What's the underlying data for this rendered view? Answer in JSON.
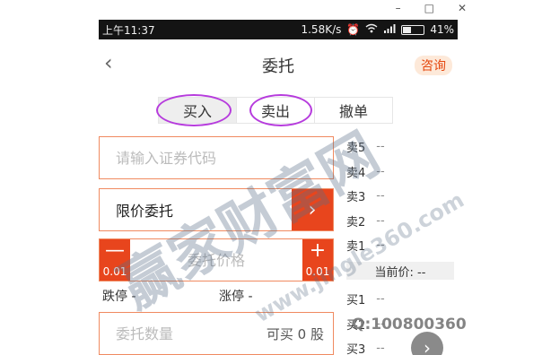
{
  "window": {
    "minimize_glyph": "–",
    "maximize_glyph": "□",
    "close_glyph": "✕"
  },
  "statusbar": {
    "time": "上午11:37",
    "net_speed": "1.58K/s",
    "battery": "41%",
    "battery_level": 0.41,
    "icons": [
      "alarm-icon",
      "wifi-icon",
      "signal-icon",
      "battery-icon"
    ]
  },
  "header": {
    "back_glyph": "‹",
    "title": "委托",
    "consult_label": "咨询"
  },
  "tabs": [
    {
      "label": "买入",
      "active": true
    },
    {
      "label": "卖出",
      "active": false
    },
    {
      "label": "撤单",
      "active": false
    }
  ],
  "form": {
    "code_placeholder": "请输入证券代码",
    "order_type": "限价委托",
    "order_type_arrow": "›",
    "minus_glyph": "—",
    "plus_glyph": "+",
    "step_minus": "0.01",
    "step_plus": "0.01",
    "price_placeholder": "委托价格",
    "limit_down": "跌停 -",
    "limit_up": "涨停 -",
    "qty_placeholder": "委托数量",
    "can_buy": "可买 0 股"
  },
  "book": {
    "sells": [
      {
        "label": "卖5",
        "value": "--"
      },
      {
        "label": "卖4",
        "value": "--"
      },
      {
        "label": "卖3",
        "value": "--"
      },
      {
        "label": "卖2",
        "value": "--"
      },
      {
        "label": "卖1",
        "value": "--"
      }
    ],
    "current_price": "当前价: --",
    "buys": [
      {
        "label": "买1",
        "value": "--"
      },
      {
        "label": "买2",
        "value": "--"
      },
      {
        "label": "买3",
        "value": "--"
      }
    ]
  },
  "fab_glyph": "›",
  "watermark": {
    "brand": "赢家财富网",
    "url": "www.jingle360.com",
    "qq": "Q:100800360"
  },
  "colors": {
    "accent": "#e8451d",
    "highlight_circle": "#b63bdd",
    "statusbar_bg": "#141414",
    "consult_bg": "#fde9d9"
  }
}
